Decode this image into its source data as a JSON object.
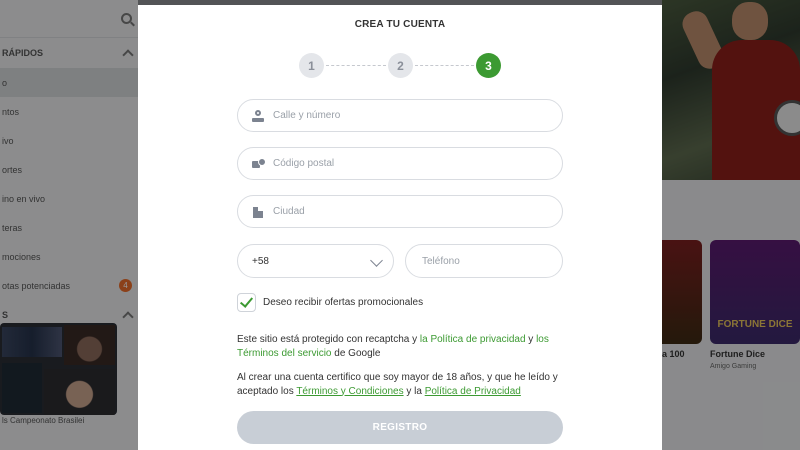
{
  "background": {
    "sidebar": {
      "section_1": "RÁPIDOS",
      "items": [
        {
          "label": "o",
          "active": true
        },
        {
          "label": "ntos"
        },
        {
          "label": "ivo"
        },
        {
          "label": "ortes"
        },
        {
          "label": "ino en vivo"
        },
        {
          "label": "teras"
        },
        {
          "label": "mociones"
        },
        {
          "label": "otas potenciadas",
          "badge": "4"
        }
      ],
      "section_2": "S"
    },
    "stream_caption": "ls Campeonato Brasilei",
    "games": [
      {
        "title": "a 100",
        "sub": ""
      },
      {
        "title": "Fortune Dice",
        "sub": "Amigo Gaming",
        "art_text": "FORTUNE DICE"
      }
    ]
  },
  "modal": {
    "title": "CREA TU CUENTA",
    "steps": [
      "1",
      "2",
      "3"
    ],
    "active_step": 3,
    "fields": {
      "street_placeholder": "Calle y número",
      "postal_placeholder": "Código postal",
      "city_placeholder": "Ciudad",
      "country_code": "+58",
      "phone_placeholder": "Teléfono"
    },
    "promo": {
      "checked": true,
      "label": "Deseo recibir ofertas promocionales"
    },
    "recaptcha": {
      "text_1": "Este sitio está protegido con recaptcha y ",
      "link_1": "la Política de privacidad",
      "text_2": " y ",
      "link_2": "los Términos del servicio",
      "text_3": " de Google"
    },
    "legal": {
      "text_1": "Al crear una cuenta certifico que soy mayor de 18 años, y que he leído y aceptado los ",
      "link_1": "Términos y Condiciones",
      "text_2": " y la ",
      "link_2": "Política de Privacidad"
    },
    "submit_label": "REGISTRO"
  },
  "colors": {
    "accent_green": "#3c9a32",
    "button_disabled": "#c8ced6"
  }
}
